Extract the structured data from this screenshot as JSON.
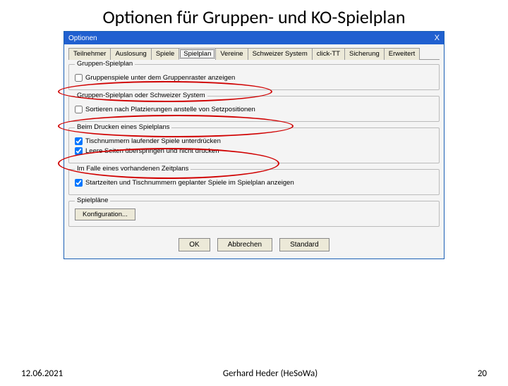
{
  "slide": {
    "title": "Optionen für Gruppen- und KO-Spielplan"
  },
  "dialog": {
    "title": "Optionen",
    "close": "X",
    "tabs": {
      "teilnehmer": "Teilnehmer",
      "auslosung": "Auslosung",
      "spiele": "Spiele",
      "spielplan": "Spielplan",
      "vereine": "Vereine",
      "schweizer": "Schweizer System",
      "clicktt": "click-TT",
      "sicherung": "Sicherung",
      "erweitert": "Erweitert"
    },
    "groups": {
      "g1": {
        "legend": "Gruppen-Spielplan",
        "cb1": "Gruppenspiele unter dem Gruppenraster anzeigen"
      },
      "g2": {
        "legend": "Gruppen-Spielplan oder Schweizer System",
        "cb1": "Sortieren nach Platzierungen anstelle von Setzpositionen"
      },
      "g3": {
        "legend": "Beim Drucken eines Spielplans",
        "cb1": "Tischnummern laufender Spiele unterdrücken",
        "cb2": "Leere Seiten überspringen und nicht drucken"
      },
      "g4": {
        "legend": "Im Falle eines vorhandenen Zeitplans",
        "cb1": "Startzeiten und Tischnummern geplanter Spiele im Spielplan anzeigen"
      },
      "g5": {
        "legend": "Spielpläne",
        "btn": "Konfiguration..."
      }
    },
    "buttons": {
      "ok": "OK",
      "cancel": "Abbrechen",
      "standard": "Standard"
    }
  },
  "footer": {
    "date": "12.06.2021",
    "author": "Gerhard Heder (HeSoWa)",
    "page": "20"
  }
}
